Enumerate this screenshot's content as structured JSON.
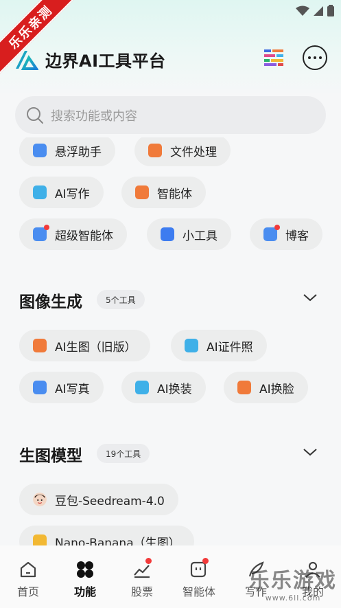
{
  "app": {
    "title": "边界AI工具平台"
  },
  "search": {
    "placeholder": "搜索功能或内容"
  },
  "section_top": {
    "items": [
      {
        "label": "悬浮助手",
        "icon": "float-assistant-icon",
        "color": "#4a8df0"
      },
      {
        "label": "文件处理",
        "icon": "file-process-icon",
        "color": "#f07a3a"
      },
      {
        "label": "AI写作",
        "icon": "ai-writing-icon",
        "color": "#3fb0e8"
      },
      {
        "label": "智能体",
        "icon": "agent-icon",
        "color": "#f07a3a"
      },
      {
        "label": "超级智能体",
        "icon": "super-agent-icon",
        "color": "#4a8df0",
        "badge": true
      },
      {
        "label": "小工具",
        "icon": "small-tools-icon",
        "color": "#3d7cf0"
      },
      {
        "label": "博客",
        "icon": "blog-icon",
        "color": "#4a8df0",
        "badge": true
      }
    ]
  },
  "section_image": {
    "title": "图像生成",
    "count": "5个工具",
    "items": [
      {
        "label": "AI生图（旧版）",
        "icon": "ai-image-old-icon",
        "color": "#f07a3a"
      },
      {
        "label": "AI证件照",
        "icon": "ai-id-photo-icon",
        "color": "#3fb0e8"
      },
      {
        "label": "AI写真",
        "icon": "ai-portrait-icon",
        "color": "#4a8df0"
      },
      {
        "label": "AI换装",
        "icon": "ai-outfit-icon",
        "color": "#3fb0e8"
      },
      {
        "label": "AI换脸",
        "icon": "ai-faceswap-icon",
        "color": "#f07a3a"
      }
    ]
  },
  "section_models": {
    "title": "生图模型",
    "count": "19个工具",
    "items": [
      {
        "label": "豆包-Seedream-4.0",
        "icon": "doubao-avatar-icon"
      },
      {
        "label": "Nano-Banana（生图）",
        "icon": "banana-icon"
      }
    ]
  },
  "tabbar": {
    "tabs": [
      {
        "label": "首页",
        "icon": "home-icon"
      },
      {
        "label": "功能",
        "icon": "grid-icon",
        "active": true
      },
      {
        "label": "股票",
        "icon": "stock-chart-icon",
        "badge": true
      },
      {
        "label": "智能体",
        "icon": "agent-tab-icon",
        "badge": true
      },
      {
        "label": "写作",
        "icon": "feather-pen-icon"
      },
      {
        "label": "我的",
        "icon": "profile-icon"
      }
    ]
  },
  "overlay": {
    "ribbon": "乐乐亲测",
    "watermark": "乐乐游戏",
    "watermark_url": "www.6ll.com"
  },
  "colors": {
    "accent": "#1aa89a",
    "badge": "#f23a3a",
    "pill_bg": "#eceded"
  }
}
